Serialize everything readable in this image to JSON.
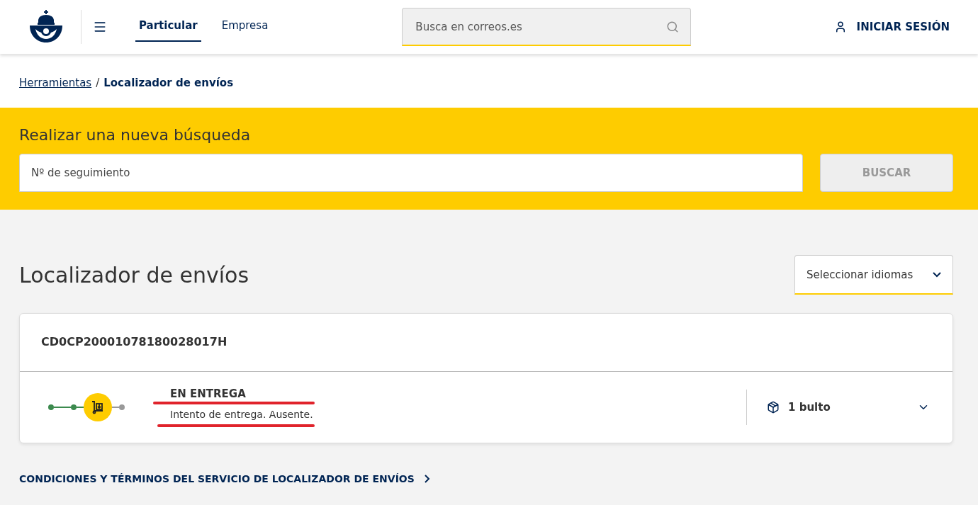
{
  "header": {
    "nav": [
      {
        "label": "Particular",
        "selected": true
      },
      {
        "label": "Empresa",
        "selected": false
      }
    ],
    "search": {
      "placeholder": "Busca en correos.es"
    },
    "login": "INICIAR SESIÓN"
  },
  "breadcrumb": {
    "link": "Herramientas",
    "separator": "/",
    "current": "Localizador de envíos"
  },
  "new_search": {
    "title": "Realizar una nueva búsqueda",
    "field": {
      "placeholder": "Nº de seguimiento"
    },
    "button": "BUSCAR"
  },
  "page": {
    "title": "Localizador de envíos",
    "language_select": "Seleccionar idiomas"
  },
  "shipment": {
    "code": "CD0CP20001078180028017H",
    "steps": [
      {
        "kind": "done"
      },
      {
        "kind": "done"
      },
      {
        "kind": "current"
      },
      {
        "kind": "pending"
      }
    ],
    "status_title": "EN ENTREGA",
    "status_detail": "Intento de entrega. Ausente.",
    "packages": "1 bulto"
  },
  "footer_link": "CONDICIONES Y TÉRMINOS DEL SERVICIO DE LOCALIZADOR DE ENVÍOS"
}
